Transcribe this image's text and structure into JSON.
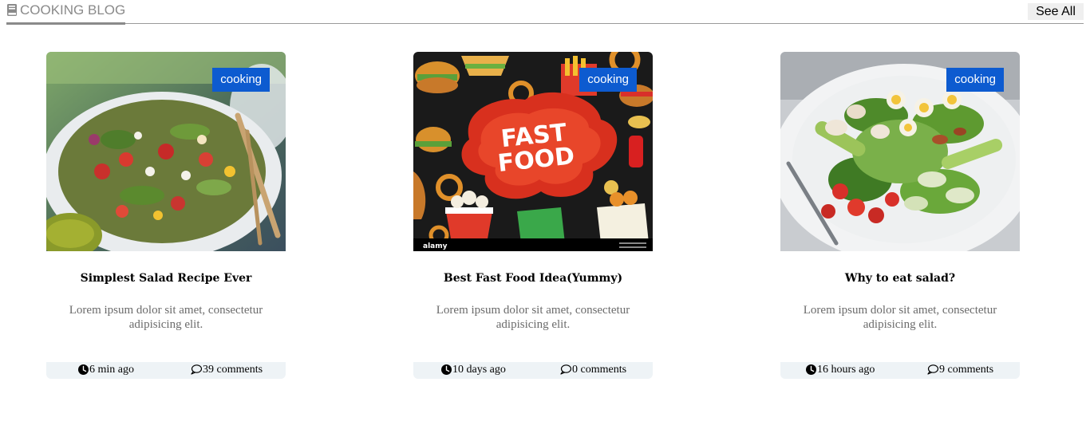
{
  "header": {
    "title": "COOKING BLOG",
    "see_all_label": "See All",
    "icon": "book-icon"
  },
  "colors": {
    "accent": "#0d5bd0",
    "footer_bg": "#eef3f6",
    "header_text": "#8a8a8a"
  },
  "posts": [
    {
      "image": "salad-bowl-photo",
      "tag": "cooking",
      "title": "Simplest Salad Recipe Ever",
      "description": "Lorem ipsum dolor sit amet, consectetur adipisicing elit.",
      "time": "6 min ago",
      "comments": "39 comments"
    },
    {
      "image": "fast-food-poster",
      "tag": "cooking",
      "title": "Best Fast Food Idea(Yummy)",
      "description": "Lorem ipsum dolor sit amet, consectetur adipisicing elit.",
      "time": "10 days ago",
      "comments": "0 comments",
      "image_text": "FAST FOOD",
      "watermark": "alamy"
    },
    {
      "image": "egg-chicken-salad-photo",
      "tag": "cooking",
      "title": "Why to eat salad?",
      "description": "Lorem ipsum dolor sit amet, consectetur adipisicing elit.",
      "time": "16 hours ago",
      "comments": "9 comments"
    }
  ]
}
